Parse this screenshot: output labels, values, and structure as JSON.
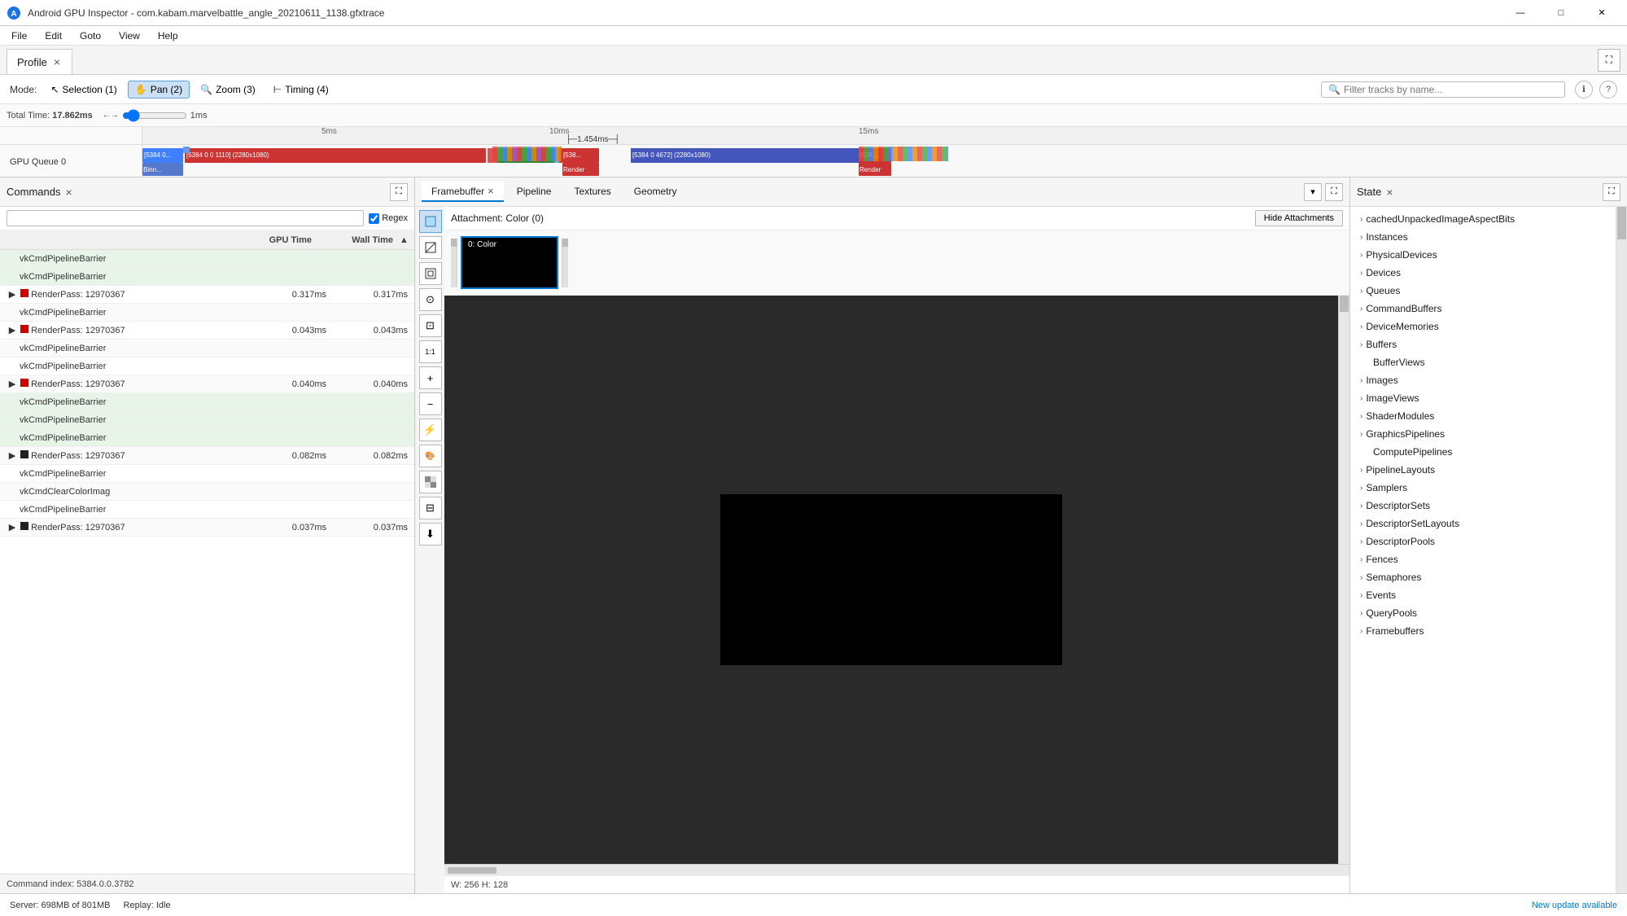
{
  "window": {
    "title": "Android GPU Inspector - com.kabam.marvelbattle_angle_20210611_1138.gfxtrace",
    "controls": {
      "minimize": "—",
      "maximize": "□",
      "close": "✕"
    }
  },
  "menu": {
    "items": [
      "File",
      "Edit",
      "Goto",
      "View",
      "Help"
    ]
  },
  "profile_tab": {
    "label": "Profile",
    "close": "×"
  },
  "mode_bar": {
    "mode_label": "Mode:",
    "modes": [
      {
        "id": "selection",
        "label": "Selection (1)",
        "icon": "↖",
        "active": false
      },
      {
        "id": "pan",
        "label": "Pan (2)",
        "icon": "✋",
        "active": true
      },
      {
        "id": "zoom",
        "label": "Zoom (3)",
        "icon": "🔍",
        "active": false
      },
      {
        "id": "timing",
        "label": "Timing (4)",
        "icon": "⊢",
        "active": false
      }
    ],
    "filter_placeholder": "Filter tracks by name...",
    "help_icon": "?",
    "info_icon": "ℹ"
  },
  "timeline": {
    "total_time_label": "Total Time:",
    "total_time": "17.862ms",
    "slider_label": "1ms",
    "markers": [
      "5ms",
      "10ms",
      "15ms"
    ],
    "duration_label": "1.454ms",
    "gpu_queue_label": "GPU Queue 0",
    "track_items": [
      {
        "label": "[5384 0...",
        "sub": "Binn...",
        "color": "#4080ff"
      },
      {
        "label": "[5384 0 0 1110] (2280x1080)",
        "sub": "",
        "color": "#e84040"
      },
      {
        "label": "[538...",
        "sub": "Render",
        "color": "#e84040"
      },
      {
        "label": "[5384 0 4672] (2280x1080)",
        "sub": "",
        "color": "#4060cc"
      },
      {
        "label": "[538...",
        "sub": "Render",
        "color": "#e84040"
      }
    ]
  },
  "commands_panel": {
    "title": "Commands",
    "close": "×",
    "expand": "⛶",
    "search_placeholder": "🔍",
    "regex_label": "Regex",
    "columns": {
      "name": "",
      "gpu_time": "GPU Time",
      "wall_time": "Wall Time"
    },
    "rows": [
      {
        "indent": 1,
        "name": "vkCmdPipelineBarrier",
        "type": "plain",
        "highlight": true
      },
      {
        "indent": 1,
        "name": "vkCmdPipelineBarrier",
        "type": "plain",
        "highlight": true
      },
      {
        "indent": 0,
        "name": "RenderPass: 12970367",
        "type": "renderpass",
        "color": "red",
        "gpu": "0.317ms",
        "wall": "0.317ms",
        "highlight": false
      },
      {
        "indent": 1,
        "name": "vkCmdPipelineBarrier",
        "type": "plain",
        "highlight": false
      },
      {
        "indent": 0,
        "name": "RenderPass: 12970367",
        "type": "renderpass",
        "color": "red",
        "gpu": "0.043ms",
        "wall": "0.043ms",
        "highlight": false
      },
      {
        "indent": 1,
        "name": "vkCmdPipelineBarrier",
        "type": "plain",
        "highlight": false
      },
      {
        "indent": 1,
        "name": "vkCmdPipelineBarrier",
        "type": "plain",
        "highlight": false
      },
      {
        "indent": 0,
        "name": "RenderPass: 12970367",
        "type": "renderpass",
        "color": "red",
        "gpu": "0.040ms",
        "wall": "0.040ms",
        "highlight": false
      },
      {
        "indent": 1,
        "name": "vkCmdPipelineBarrier",
        "type": "plain",
        "highlight": true
      },
      {
        "indent": 1,
        "name": "vkCmdPipelineBarrier",
        "type": "plain",
        "highlight": true
      },
      {
        "indent": 1,
        "name": "vkCmdPipelineBarrier",
        "type": "plain",
        "highlight": true
      },
      {
        "indent": 0,
        "name": "RenderPass: 12970367",
        "type": "renderpass",
        "color": "black",
        "gpu": "0.082ms",
        "wall": "0.082ms",
        "highlight": false
      },
      {
        "indent": 1,
        "name": "vkCmdPipelineBarrier",
        "type": "plain",
        "highlight": false
      },
      {
        "indent": 1,
        "name": "vkCmdClearColorImag",
        "type": "plain",
        "highlight": false
      },
      {
        "indent": 1,
        "name": "vkCmdPipelineBarrier",
        "type": "plain",
        "highlight": false
      },
      {
        "indent": 0,
        "name": "RenderPass: 12970367",
        "type": "renderpass",
        "color": "black",
        "gpu": "0.037ms",
        "wall": "0.037ms",
        "highlight": false
      }
    ],
    "command_index": "Command index: 5384.0.0.3782"
  },
  "framebuffer_panel": {
    "tabs": [
      {
        "label": "Framebuffer",
        "active": true,
        "closable": true
      },
      {
        "label": "Pipeline",
        "active": false,
        "closable": false
      },
      {
        "label": "Textures",
        "active": false,
        "closable": false
      },
      {
        "label": "Geometry",
        "active": false,
        "closable": false
      }
    ],
    "expand": "⛶",
    "dropdown": "▾",
    "attachment_label": "Attachment: Color (0)",
    "hide_attachments": "Hide Attachments",
    "thumbnail": {
      "label": "0: Color"
    },
    "tools": [
      "□",
      "△",
      "▽",
      "●",
      "⊡",
      "1:1",
      "🔍+",
      "🔍-",
      "⚡",
      "🎨",
      "⊠",
      "⊟",
      "⬇"
    ],
    "dimensions": "W: 256 H: 128"
  },
  "state_panel": {
    "title": "State",
    "close": "×",
    "expand": "⛶",
    "items": [
      {
        "label": "cachedUnpackedImageAspectBits",
        "indent": 0,
        "expandable": true
      },
      {
        "label": "Instances",
        "indent": 0,
        "expandable": true
      },
      {
        "label": "PhysicalDevices",
        "indent": 0,
        "expandable": true
      },
      {
        "label": "Devices",
        "indent": 0,
        "expandable": true
      },
      {
        "label": "Queues",
        "indent": 0,
        "expandable": true
      },
      {
        "label": "CommandBuffers",
        "indent": 0,
        "expandable": true
      },
      {
        "label": "DeviceMemories",
        "indent": 0,
        "expandable": true
      },
      {
        "label": "Buffers",
        "indent": 0,
        "expandable": true
      },
      {
        "label": "BufferViews",
        "indent": 1,
        "expandable": false
      },
      {
        "label": "Images",
        "indent": 0,
        "expandable": true
      },
      {
        "label": "ImageViews",
        "indent": 0,
        "expandable": true
      },
      {
        "label": "ShaderModules",
        "indent": 0,
        "expandable": true
      },
      {
        "label": "GraphicsPipelines",
        "indent": 0,
        "expandable": true
      },
      {
        "label": "ComputePipelines",
        "indent": 1,
        "expandable": false
      },
      {
        "label": "PipelineLayouts",
        "indent": 0,
        "expandable": true
      },
      {
        "label": "Samplers",
        "indent": 0,
        "expandable": true
      },
      {
        "label": "DescriptorSets",
        "indent": 0,
        "expandable": true
      },
      {
        "label": "DescriptorSetLayouts",
        "indent": 0,
        "expandable": true
      },
      {
        "label": "DescriptorPools",
        "indent": 0,
        "expandable": true
      },
      {
        "label": "Fences",
        "indent": 0,
        "expandable": true
      },
      {
        "label": "Semaphores",
        "indent": 0,
        "expandable": true
      },
      {
        "label": "Events",
        "indent": 0,
        "expandable": true
      },
      {
        "label": "QueryPools",
        "indent": 0,
        "expandable": true
      },
      {
        "label": "Framebuffers",
        "indent": 0,
        "expandable": true
      }
    ]
  },
  "status_bar": {
    "server": "Server: 698MB of 801MB",
    "replay": "Replay: Idle",
    "update": "New update available"
  }
}
